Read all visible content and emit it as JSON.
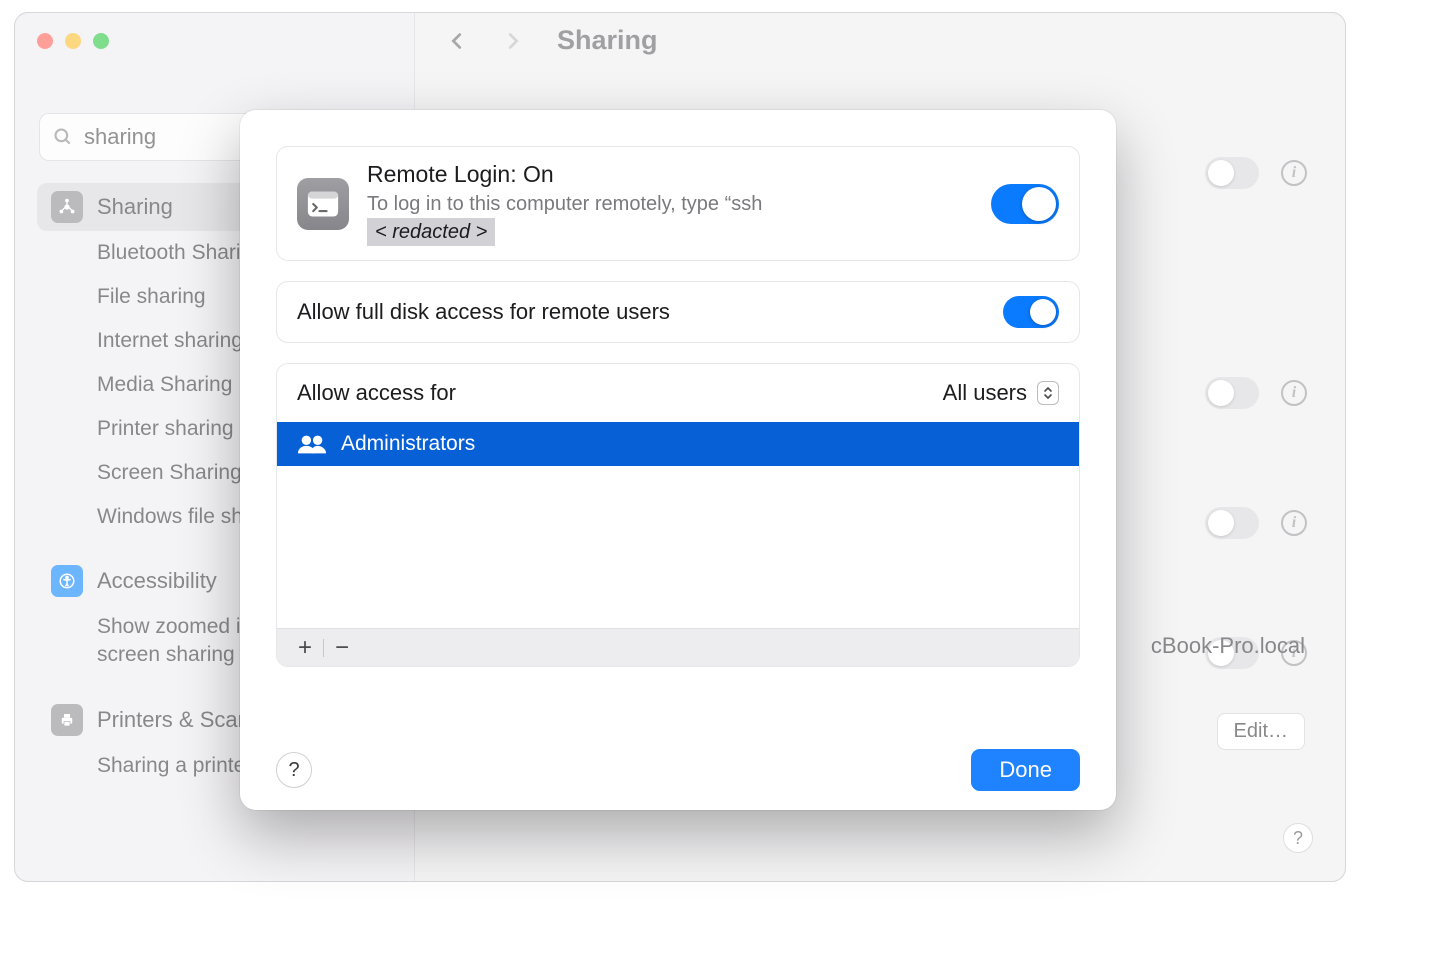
{
  "window": {
    "title": "Sharing"
  },
  "search": {
    "value": "sharing"
  },
  "sidebar": {
    "selected": "Sharing",
    "subitems": [
      "Bluetooth Sharing",
      "File sharing",
      "Internet sharing",
      "Media Sharing",
      "Printer sharing",
      "Screen Sharing",
      "Windows file sharing"
    ],
    "accessibility": "Accessibility",
    "accessibility_sub": "Show zoomed image while screen sharing",
    "printers": "Printers & Scanners",
    "printers_sub": "Sharing a printer"
  },
  "background": {
    "hostname_suffix": "cBook-Pro.local",
    "edit": "Edit…"
  },
  "modal": {
    "service_title": "Remote Login: On",
    "service_desc_prefix": "To log in to this computer remotely, type “ssh",
    "service_desc_redacted": "< redacted >",
    "full_disk": "Allow full disk access for remote users",
    "allow_access": "Allow access for",
    "access_value": "All users",
    "users": [
      "Administrators"
    ],
    "done": "Done"
  }
}
